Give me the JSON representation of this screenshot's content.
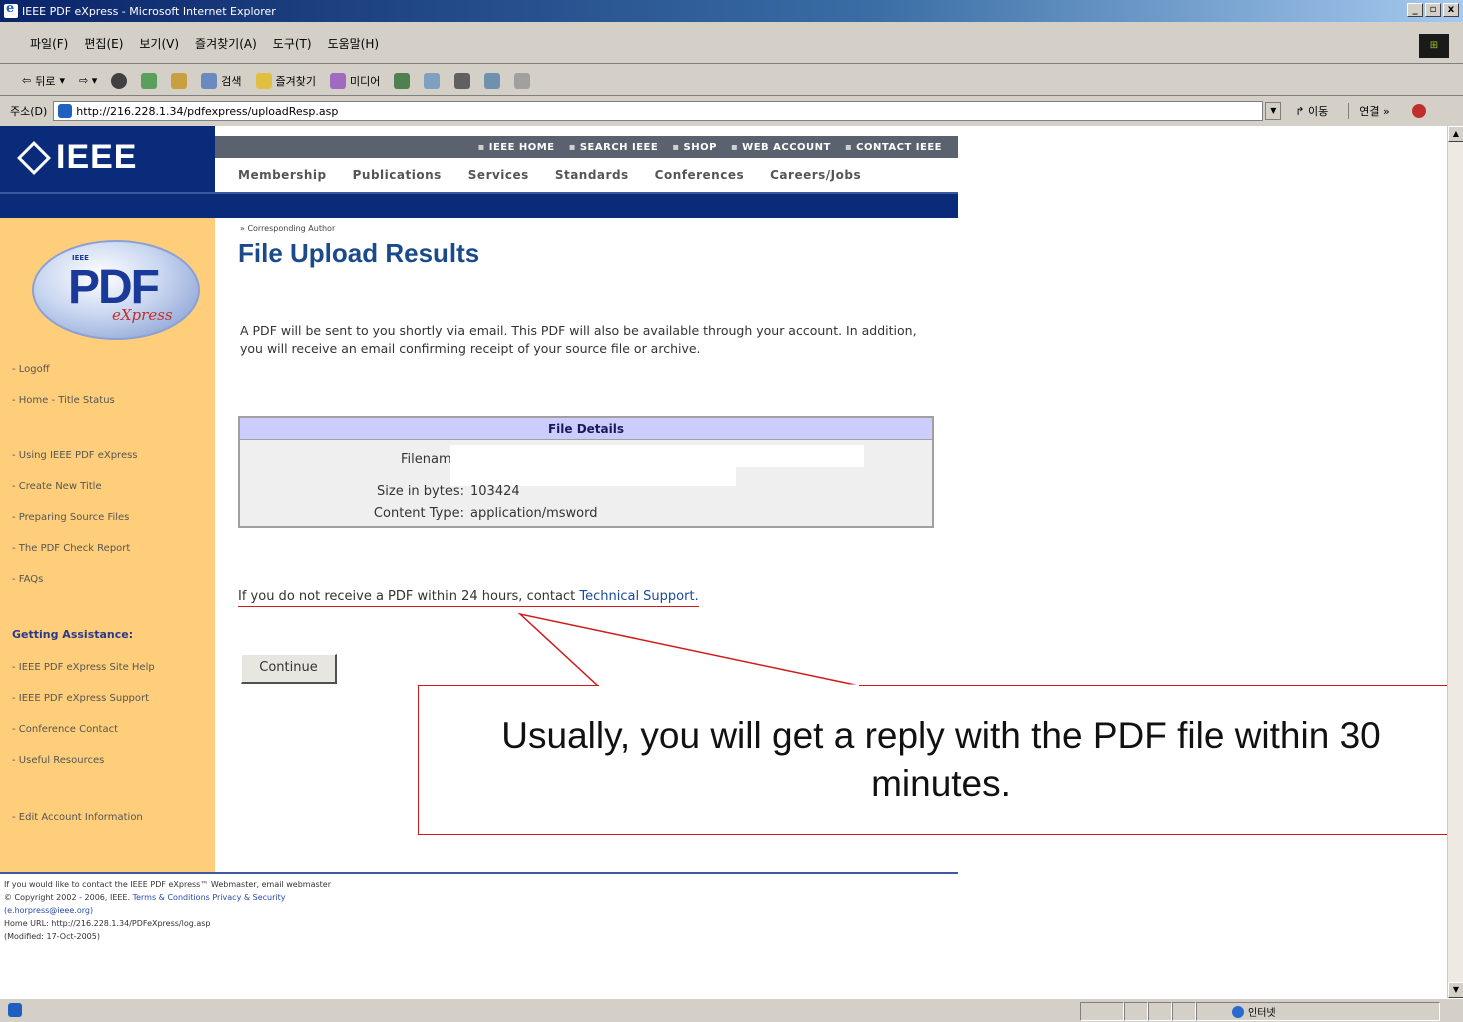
{
  "window": {
    "title": "IEEE PDF eXpress - Microsoft Internet Explorer",
    "min": "_",
    "max": "▫",
    "close": "x"
  },
  "menu": [
    "파일(F)",
    "편집(E)",
    "보기(V)",
    "즐겨찾기(A)",
    "도구(T)",
    "도움말(H)"
  ],
  "toolbar": {
    "back": "뒤로",
    "search": "검색",
    "favorites": "즐겨찾기",
    "media": "미디어"
  },
  "address": {
    "label": "주소(D)",
    "url": "http://216.228.1.34/pdfexpress/uploadResp.asp",
    "go": "이동",
    "links": "연결 »"
  },
  "topnav": [
    "IEEE HOME",
    "SEARCH IEEE",
    "SHOP",
    "WEB ACCOUNT",
    "CONTACT IEEE"
  ],
  "subnav": [
    "Membership",
    "Publications",
    "Services",
    "Standards",
    "Conferences",
    "Careers/Jobs"
  ],
  "logo": {
    "ieee": "IEEE",
    "pdf": "PDF",
    "xpress": "eXpress",
    "mini": "IEEE"
  },
  "sidebar": {
    "items": [
      "- Logoff",
      "- Home - Title Status",
      "- Using IEEE PDF eXpress",
      "- Create New Title",
      "- Preparing Source Files",
      "- The PDF Check Report",
      "- FAQs"
    ],
    "assist_head": "Getting Assistance:",
    "assist_items": [
      "- IEEE PDF eXpress Site Help",
      "- IEEE PDF eXpress Support",
      "- Conference Contact",
      "- Useful Resources"
    ],
    "account": "- Edit Account Information"
  },
  "main": {
    "breadcrumb": "» Corresponding Author",
    "title": "File Upload Results",
    "intro": "A PDF will be sent to you shortly via email. This PDF will also be available through your account. In addition, you will receive an email confirming receipt of your source file or archive.",
    "details": {
      "heading": "File Details",
      "filename_label": "Filename:",
      "size_label": "Size in bytes:",
      "size_value": "103424",
      "type_label": "Content Type:",
      "type_value": "application/msword"
    },
    "notice_text": "If you do not receive a PDF within 24 hours, contact ",
    "notice_link": "Technical Support.",
    "continue": "Continue"
  },
  "callout": "Usually, you will get a reply with the PDF file within 30 minutes.",
  "footer": {
    "line1": "If you would like to contact the IEEE PDF eXpress™ Webmaster, email webmaster",
    "line2_a": "© Copyright 2002 - 2006, IEEE.",
    "line2_b": "Terms & Conditions   Privacy & Security",
    "line3": "(e.horpress@ieee.org)",
    "line4": "Home URL: http://216.228.1.34/PDFeXpress/log.asp",
    "line5": "(Modified: 17-Oct-2005)"
  },
  "status": {
    "zone": "인터넷"
  }
}
